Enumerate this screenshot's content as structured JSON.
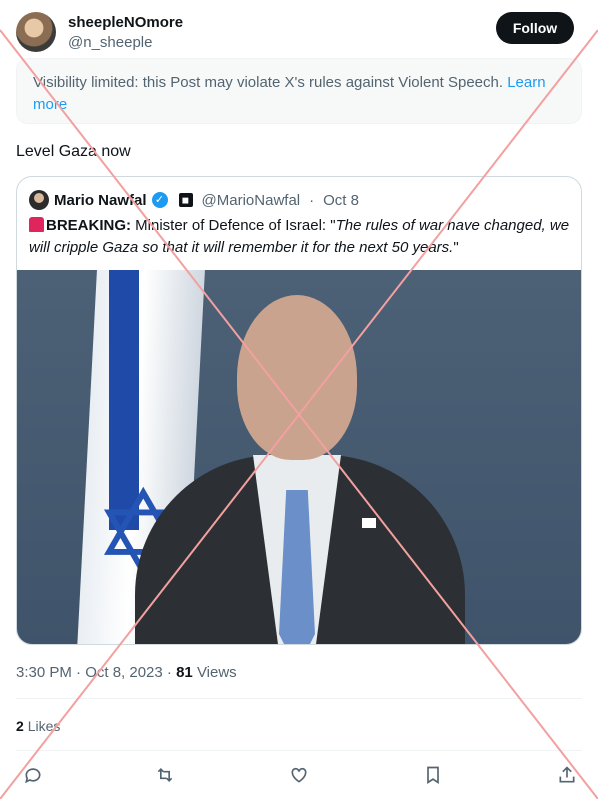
{
  "author": {
    "name": "sheepleNOmore",
    "handle": "@n_sheeple",
    "follow_label": "Follow"
  },
  "notice": {
    "text": "Visibility limited: this Post may violate X's rules against Violent Speech.",
    "link": "Learn more"
  },
  "tweet_text": "Level Gaza now",
  "quote": {
    "name": "Mario Nawfal",
    "handle": "@MarioNawfal",
    "separator": "·",
    "date": "Oct 8",
    "breaking_label": "BREAKING:",
    "body_plain": "Minister of Defence of Israel: \"",
    "body_italic": "The rules of war have changed, we will cripple Gaza so that it will remember it for the next 50 years.",
    "body_end": "\""
  },
  "meta": {
    "time": "3:30 PM · Oct 8, 2023 · ",
    "views_count": "81",
    "views_label": "Views"
  },
  "likes": {
    "count": "2",
    "label": "Likes"
  },
  "icons": [
    "reply-icon",
    "retweet-icon",
    "like-icon",
    "bookmark-icon",
    "share-icon",
    "verified-icon",
    "siren-icon"
  ],
  "colors": {
    "accent": "#1d9bf0",
    "cross": "#f2a0a0"
  }
}
